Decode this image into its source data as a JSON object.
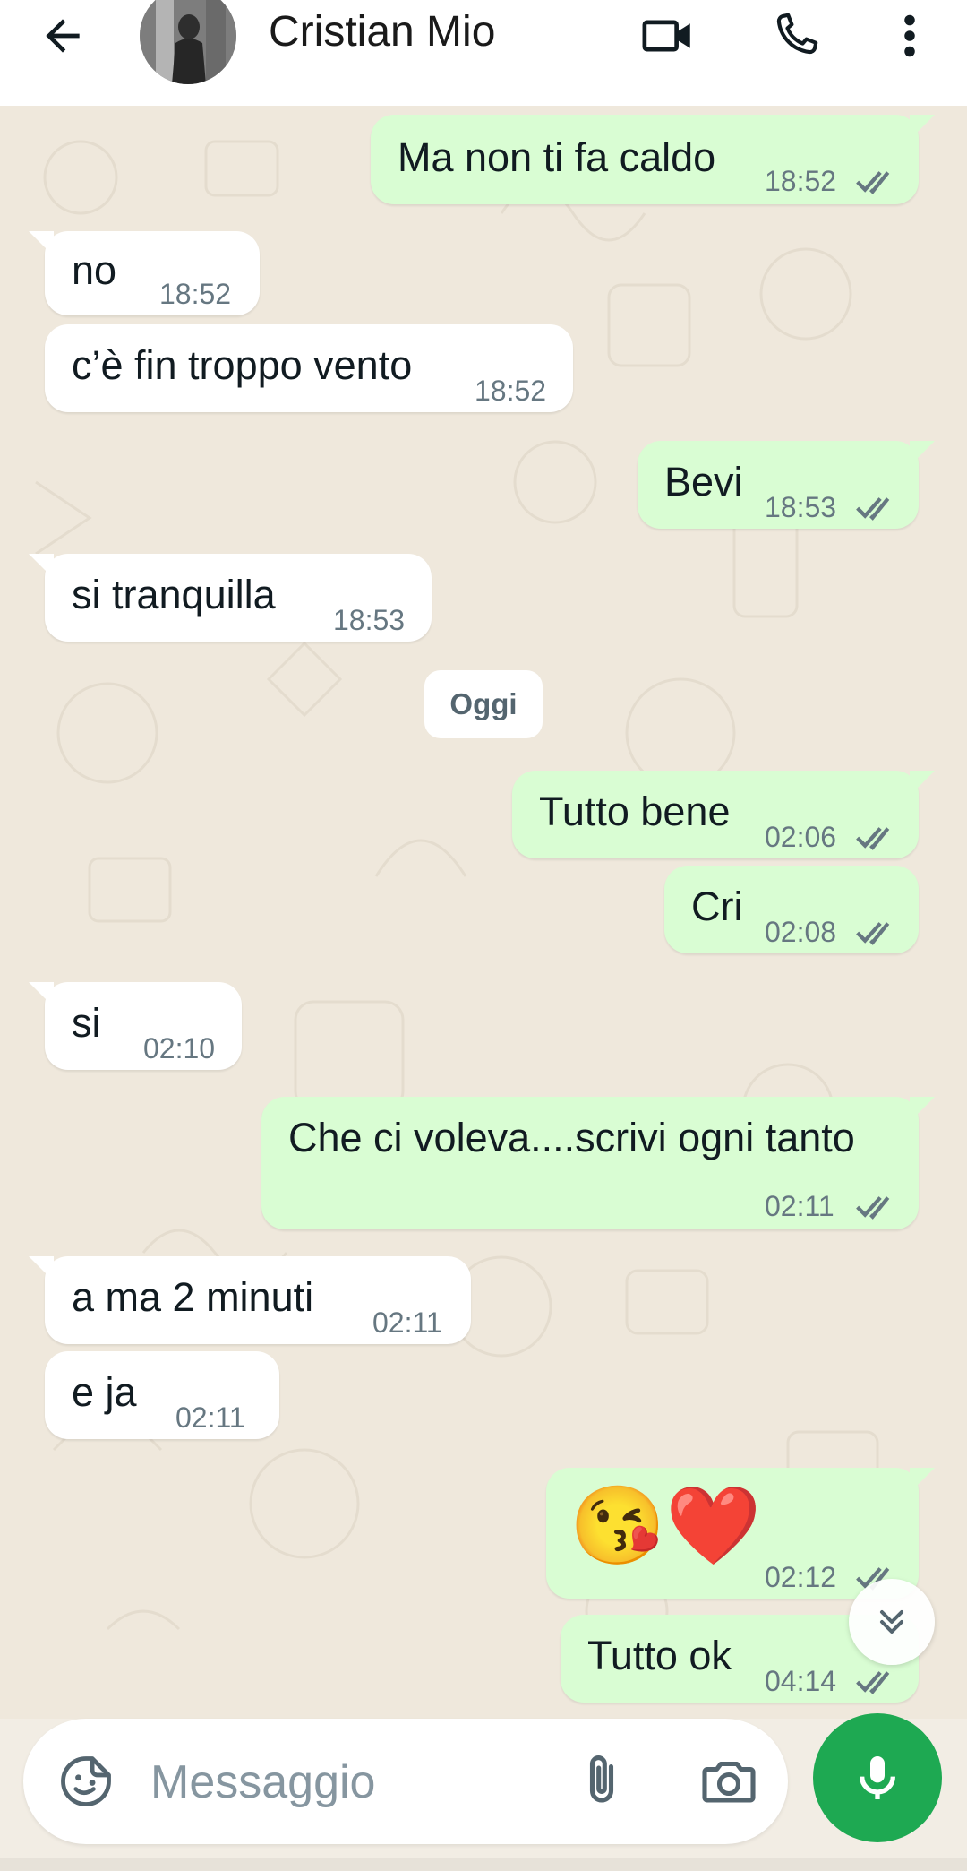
{
  "header": {
    "contact_name": "Cristian Mio",
    "icons": [
      "back-arrow-icon",
      "video-call-icon",
      "phone-icon",
      "more-options-icon"
    ]
  },
  "messages": [
    {
      "dir": "out",
      "text": "Ma non ti fa caldo",
      "time": "18:52",
      "status": "read"
    },
    {
      "dir": "in",
      "text": "no",
      "time": "18:52"
    },
    {
      "dir": "in",
      "text": "c’è fin troppo vento",
      "time": "18:52"
    },
    {
      "dir": "out",
      "text": "Bevi",
      "time": "18:53",
      "status": "read"
    },
    {
      "dir": "in",
      "text": "si tranquilla",
      "time": "18:53"
    },
    {
      "dir": "out",
      "text": "Tutto bene",
      "time": "02:06",
      "status": "read"
    },
    {
      "dir": "out",
      "text": "Cri",
      "time": "02:08",
      "status": "read"
    },
    {
      "dir": "in",
      "text": "si",
      "time": "02:10"
    },
    {
      "dir": "out",
      "text": "Che ci voleva....scrivi ogni tanto",
      "time": "02:11",
      "status": "read"
    },
    {
      "dir": "in",
      "text": "a ma 2 minuti",
      "time": "02:11"
    },
    {
      "dir": "in",
      "text": "e ja",
      "time": "02:11"
    },
    {
      "dir": "out",
      "text": "😘❤️",
      "time": "02:12",
      "status": "read"
    },
    {
      "dir": "out",
      "text": "Tutto ok",
      "time": "04:14",
      "status": "read"
    }
  ],
  "date_separator": "Oggi",
  "composer": {
    "placeholder": "Messaggio",
    "icons": [
      "sticker-icon",
      "attach-icon",
      "camera-icon",
      "mic-icon"
    ]
  },
  "colors": {
    "outgoing_bubble": "#d9fdd3",
    "incoming_bubble": "#ffffff",
    "read_ticks": "#667781",
    "mic_button": "#1ea952",
    "chat_background": "#efe8dc"
  }
}
